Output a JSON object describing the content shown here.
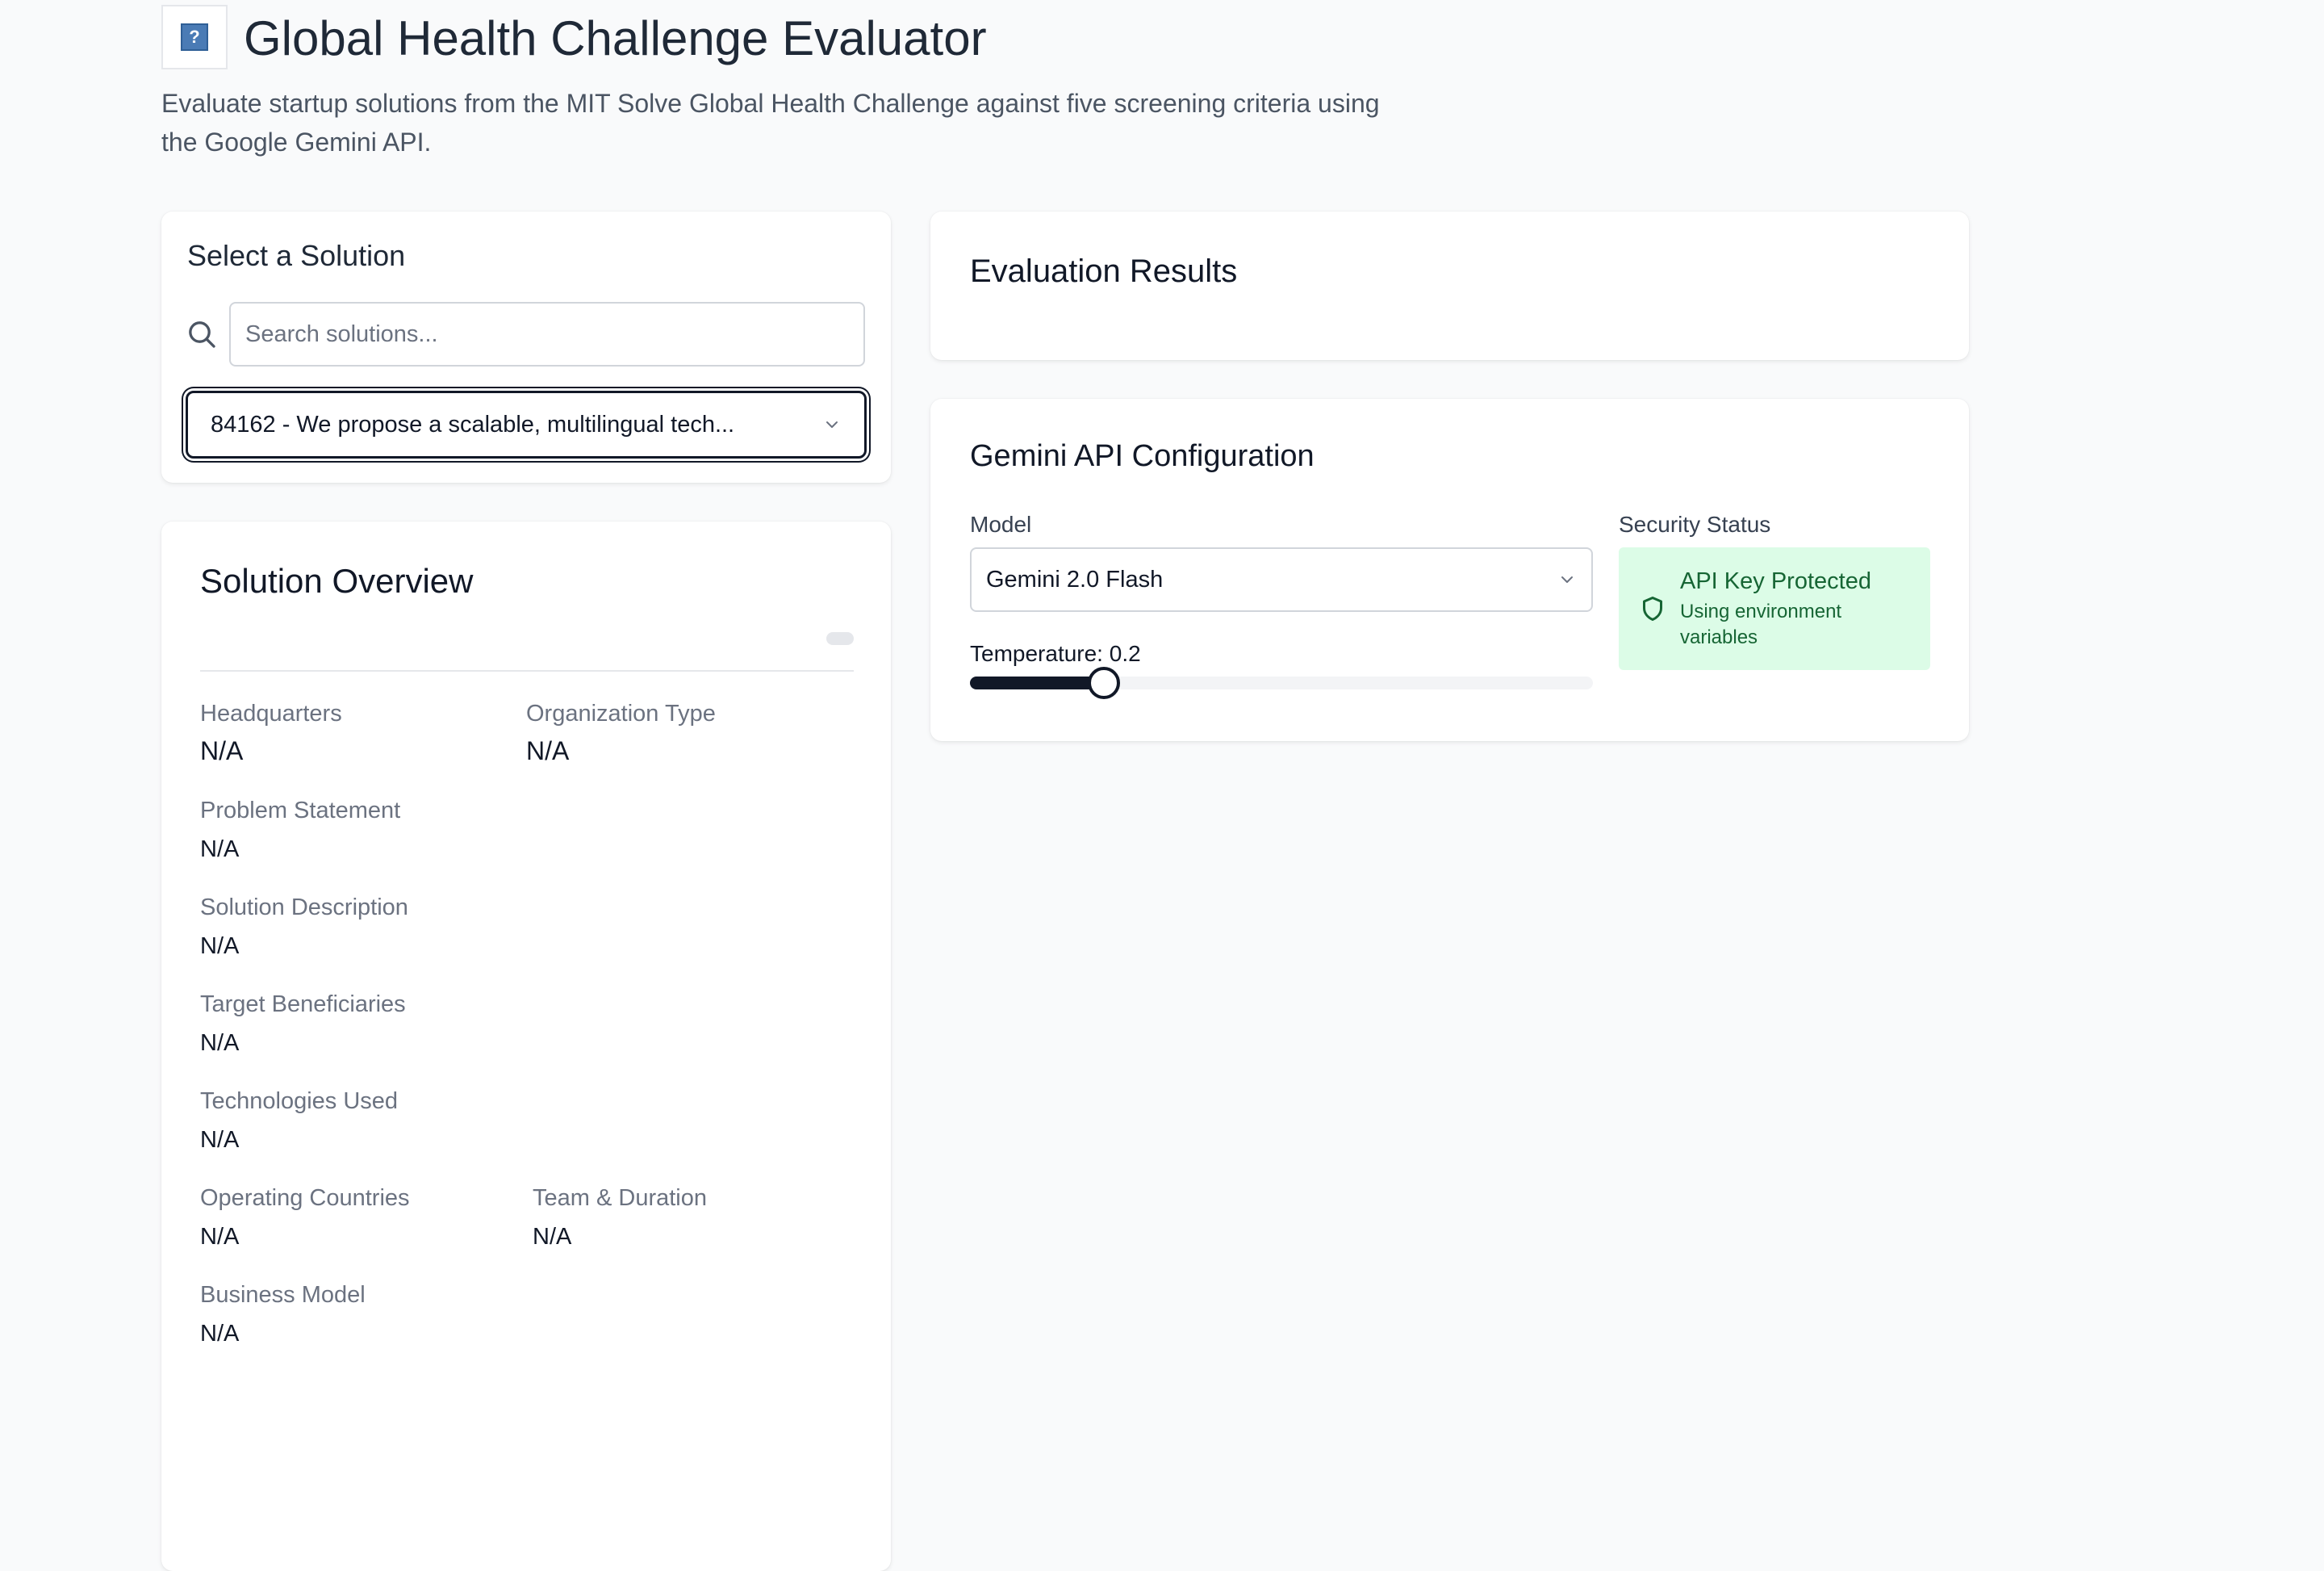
{
  "header": {
    "logo_glyph": "?",
    "title": "Global Health Challenge Evaluator",
    "subtitle": "Evaluate startup solutions from the MIT Solve Global Health Challenge against five screening criteria using the Google Gemini API."
  },
  "select_solution": {
    "title": "Select a Solution",
    "search_placeholder": "Search solutions...",
    "search_value": "",
    "selected": "84162 - We propose a scalable, multilingual tech..."
  },
  "overview": {
    "title": "Solution Overview",
    "fields": {
      "headquarters": {
        "label": "Headquarters",
        "value": "N/A"
      },
      "organization_type": {
        "label": "Organization Type",
        "value": "N/A"
      },
      "problem_statement": {
        "label": "Problem Statement",
        "value": "N/A"
      },
      "solution_description": {
        "label": "Solution Description",
        "value": "N/A"
      },
      "target_beneficiaries": {
        "label": "Target Beneficiaries",
        "value": "N/A"
      },
      "technologies_used": {
        "label": "Technologies Used",
        "value": "N/A"
      },
      "operating_countries": {
        "label": "Operating Countries",
        "value": "N/A"
      },
      "team_duration": {
        "label": "Team & Duration",
        "value": "N/A"
      },
      "business_model": {
        "label": "Business Model",
        "value": "N/A"
      }
    }
  },
  "results": {
    "title": "Evaluation Results"
  },
  "config": {
    "title": "Gemini API Configuration",
    "model_label": "Model",
    "model_value": "Gemini 2.0 Flash",
    "temperature_label": "Temperature: 0.2",
    "temperature_value": 0.2,
    "security_label": "Security Status",
    "security_title": "API Key Protected",
    "security_sub": "Using environment variables"
  },
  "colors": {
    "background": "#f9fafb",
    "card": "#ffffff",
    "text_primary": "#111827",
    "text_muted": "#6b7280",
    "security_bg": "#dcfce7",
    "security_text": "#166534"
  },
  "icons": [
    "app-logo-icon",
    "search-icon",
    "chevron-down-icon",
    "shield-icon"
  ]
}
